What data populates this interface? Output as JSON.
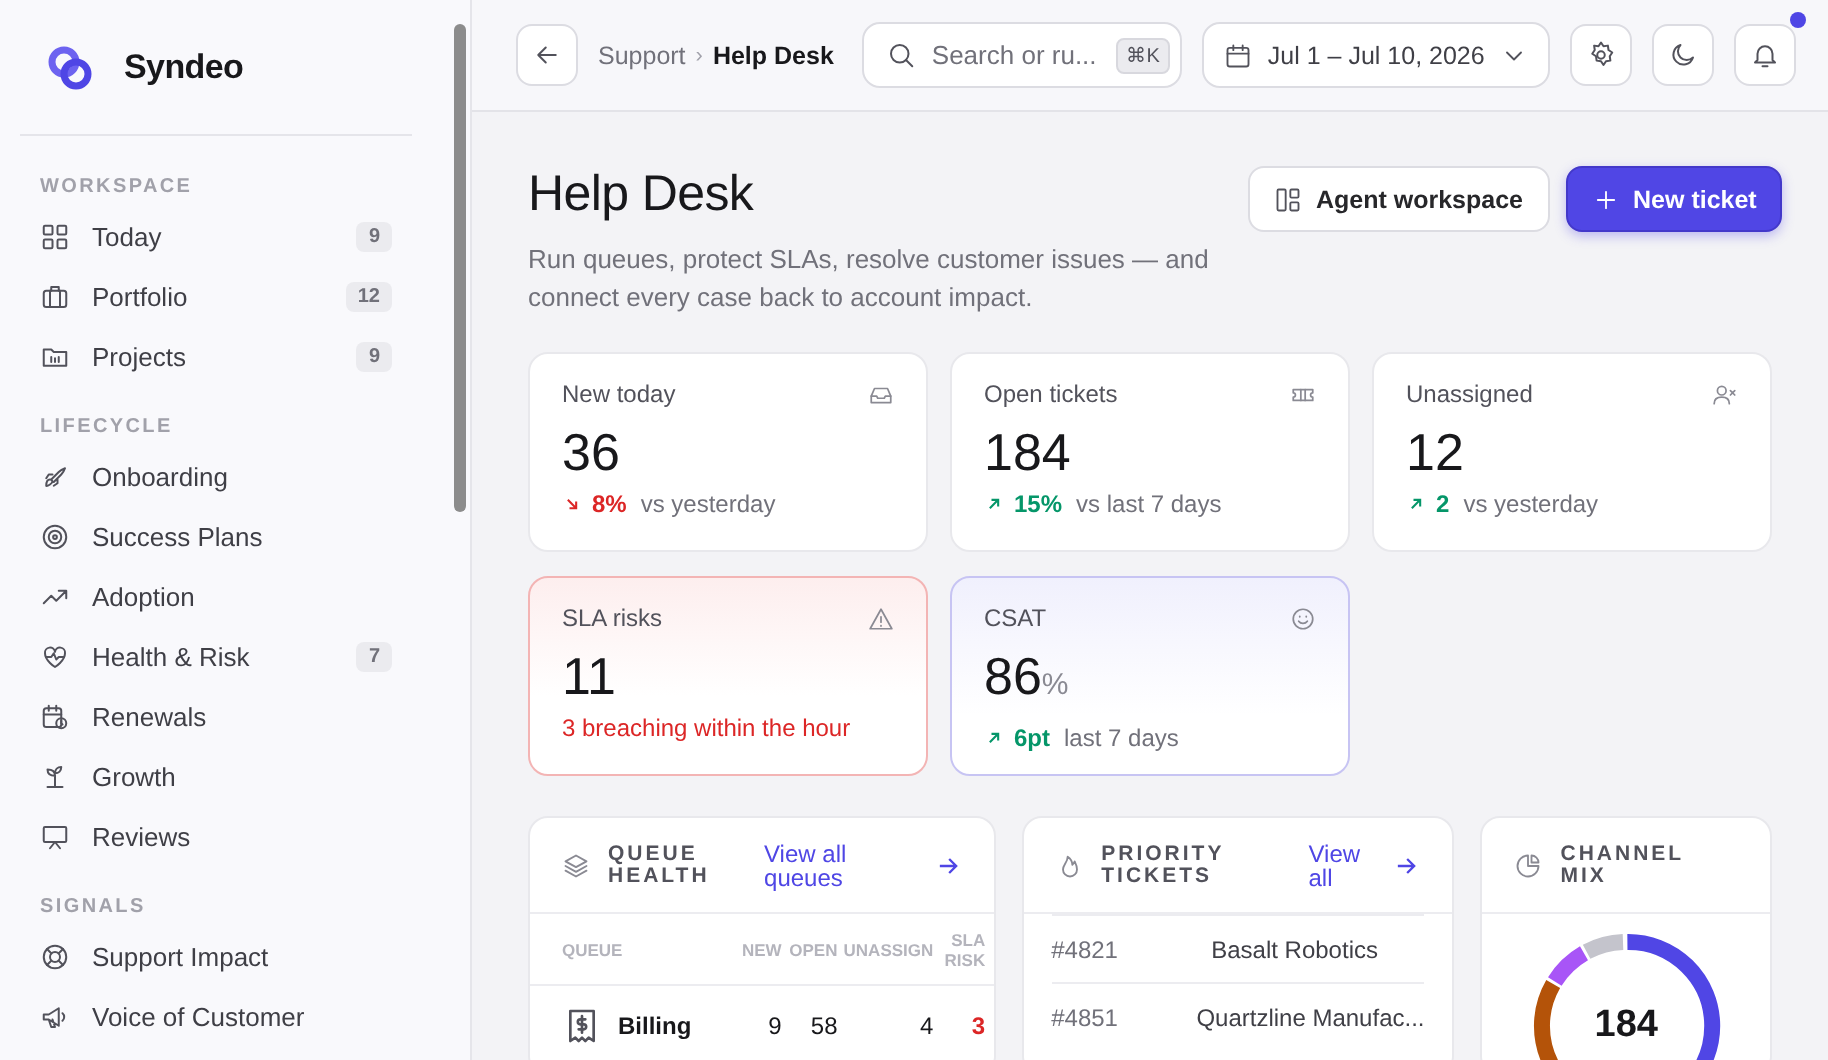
{
  "brand": {
    "name": "Syndeo"
  },
  "sidebar": {
    "sections": [
      {
        "title": "WORKSPACE",
        "items": [
          {
            "label": "Today",
            "count": "9"
          },
          {
            "label": "Portfolio",
            "count": "12"
          },
          {
            "label": "Projects",
            "count": "9"
          }
        ]
      },
      {
        "title": "LIFECYCLE",
        "items": [
          {
            "label": "Onboarding"
          },
          {
            "label": "Success Plans"
          },
          {
            "label": "Adoption"
          },
          {
            "label": "Health & Risk",
            "count": "7"
          },
          {
            "label": "Renewals"
          },
          {
            "label": "Growth"
          },
          {
            "label": "Reviews"
          }
        ]
      },
      {
        "title": "SIGNALS",
        "items": [
          {
            "label": "Support Impact"
          },
          {
            "label": "Voice of Customer"
          }
        ]
      }
    ]
  },
  "topbar": {
    "breadcrumb": [
      "Support",
      "›",
      "Help Desk"
    ],
    "search": {
      "placeholder": "Search or ru...",
      "shortcut": "⌘K"
    },
    "date_range": "Jul 1 – Jul 10, 2026",
    "notifications_unread": true
  },
  "header": {
    "title": "Help Desk",
    "subtitle": "Run queues, protect SLAs, resolve customer issues — and connect every case back to account impact.",
    "buttons": [
      {
        "label": "Agent workspace",
        "kind": "secondary"
      },
      {
        "label": "New ticket",
        "kind": "primary"
      }
    ]
  },
  "kpis": [
    {
      "label": "New today",
      "value": "36",
      "kind": "plain",
      "rising": false,
      "delta": "8%",
      "note": "vs yesterday"
    },
    {
      "label": "Open tickets",
      "value": "184",
      "kind": "plain",
      "rising": true,
      "delta": "15%",
      "note": "vs last 7 days"
    },
    {
      "label": "Unassigned",
      "value": "12",
      "kind": "plain",
      "rising": true,
      "delta": "2",
      "note": "vs yesterday"
    },
    {
      "label": "SLA risks",
      "value": "11",
      "kind": "danger",
      "note": "3 breaching within the hour"
    },
    {
      "label": "CSAT",
      "value": "86",
      "unit": "%",
      "kind": "accent",
      "rising": true,
      "delta": "6pt",
      "note": "last 7 days"
    }
  ],
  "queue_health": {
    "title": "QUEUE HEALTH",
    "link": "View all queues",
    "columns": [
      "QUEUE",
      "NEW",
      "OPEN",
      "UNASSIGN",
      "SLA RISK"
    ],
    "rows": [
      {
        "name": "Billing",
        "new": "9",
        "open": "58",
        "unassign": "4",
        "sla_risk": "3"
      }
    ]
  },
  "priority_tickets": {
    "title": "PRIORITY TICKETS",
    "link": "View all",
    "rows": [
      {
        "id": "#4821",
        "account": "Basalt Robotics"
      },
      {
        "id": "#4851",
        "account": "Quartzline Manufac..."
      }
    ]
  },
  "channel_mix": {
    "title": "CHANNEL MIX",
    "total": "184"
  }
}
